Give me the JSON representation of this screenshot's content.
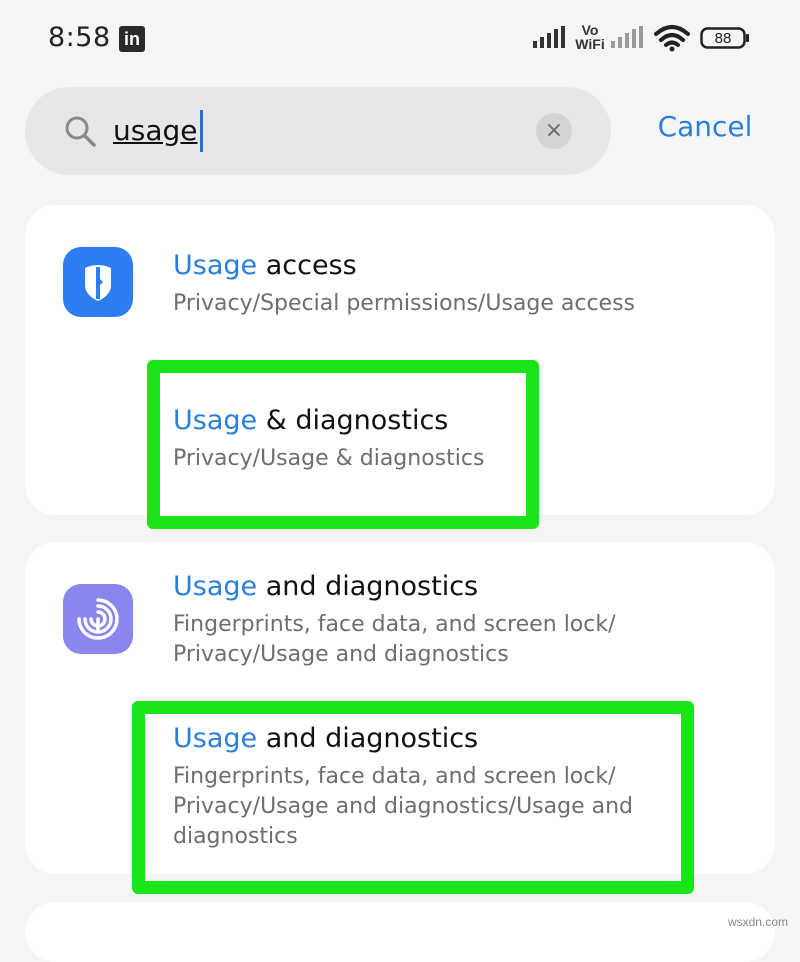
{
  "status_bar": {
    "time": "8:58",
    "notification_icon": "linkedin-icon",
    "notification_label": "in",
    "vowifi_line1": "Vo",
    "vowifi_line2": "WiFi",
    "battery": "88"
  },
  "search": {
    "value": "usage",
    "placeholder": "",
    "clear_label": "×",
    "cancel_label": "Cancel"
  },
  "results": [
    {
      "highlight": "Usage",
      "title_rest": " access",
      "path": "Privacy/Special permissions/Usage access",
      "icon": "privacy-icon"
    },
    {
      "highlight": "Usage",
      "title_rest": " & diagnostics",
      "path": "Privacy/Usage & diagnostics"
    },
    {
      "highlight": "Usage",
      "title_rest": " and diagnostics",
      "path": "Fingerprints, face data, and screen lock/\nPrivacy/Usage and diagnostics",
      "icon": "fingerprint-icon"
    },
    {
      "highlight": "Usage",
      "title_rest": " and diagnostics",
      "path": "Fingerprints, face data, and screen lock/\nPrivacy/Usage and diagnostics/Usage and\ndiagnostics"
    }
  ],
  "colors": {
    "accent": "#2a7fdc",
    "annotation_box": "#1be41b",
    "privacy_icon_bg": "#2f7df2",
    "fingerprint_icon_bg": "#8a86ef"
  },
  "watermark": "wsxdn.com"
}
